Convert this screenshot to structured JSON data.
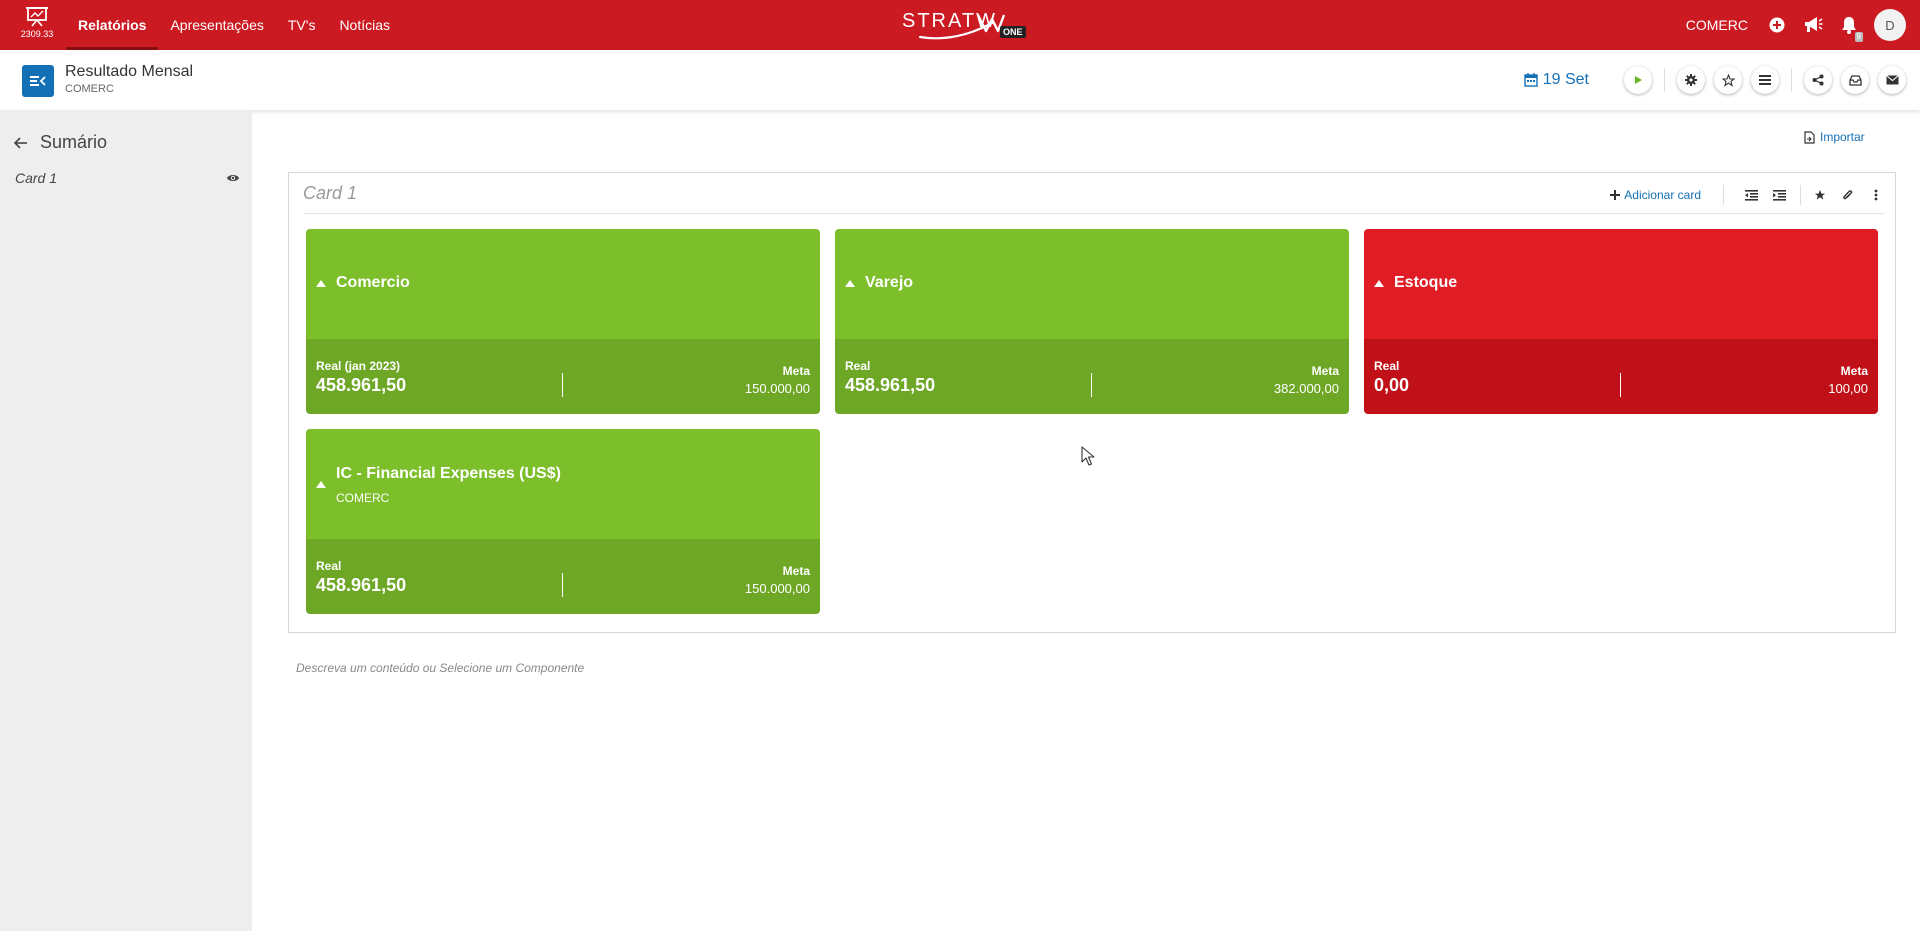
{
  "topnav": {
    "version": "2309.33",
    "items": [
      {
        "label": "Relatórios",
        "active": true
      },
      {
        "label": "Apresentações",
        "active": false
      },
      {
        "label": "TV's",
        "active": false
      },
      {
        "label": "Notícias",
        "active": false
      }
    ],
    "brand": "STRATW",
    "brand_badge": "ONE",
    "company": "COMERC",
    "notification_count": "9",
    "avatar_initial": "D",
    "color": "#cc1a22"
  },
  "header": {
    "title": "Resultado Mensal",
    "subtitle": "COMERC",
    "date": "19 Set",
    "accent": "#1470b5"
  },
  "sidebar": {
    "title": "Sumário",
    "items": [
      {
        "label": "Card 1"
      }
    ]
  },
  "main": {
    "import_label": "Importar",
    "panel": {
      "title": "Card 1",
      "add_card_label": "Adicionar card",
      "cards": [
        {
          "title": "Comercio",
          "subtitle": "",
          "real_label": "Real (jan 2023)",
          "real_value": "458.961,50",
          "meta_label": "Meta",
          "meta_value": "150.000,00",
          "status": "green"
        },
        {
          "title": "Varejo",
          "subtitle": "",
          "real_label": "Real",
          "real_value": "458.961,50",
          "meta_label": "Meta",
          "meta_value": "382.000,00",
          "status": "green"
        },
        {
          "title": "Estoque",
          "subtitle": "",
          "real_label": "Real",
          "real_value": "0,00",
          "meta_label": "Meta",
          "meta_value": "100,00",
          "status": "red"
        },
        {
          "title": "IC - Financial Expenses (US$)",
          "subtitle": "COMERC",
          "real_label": "Real",
          "real_value": "458.961,50",
          "meta_label": "Meta",
          "meta_value": "150.000,00",
          "status": "green"
        }
      ]
    },
    "hint": "Descreva um conteúdo ou Selecione um Componente"
  },
  "colors": {
    "green_top": "#7cbf2b",
    "green_bottom": "#6ea725",
    "red_top": "#e01d25",
    "red_bottom": "#c11118"
  }
}
